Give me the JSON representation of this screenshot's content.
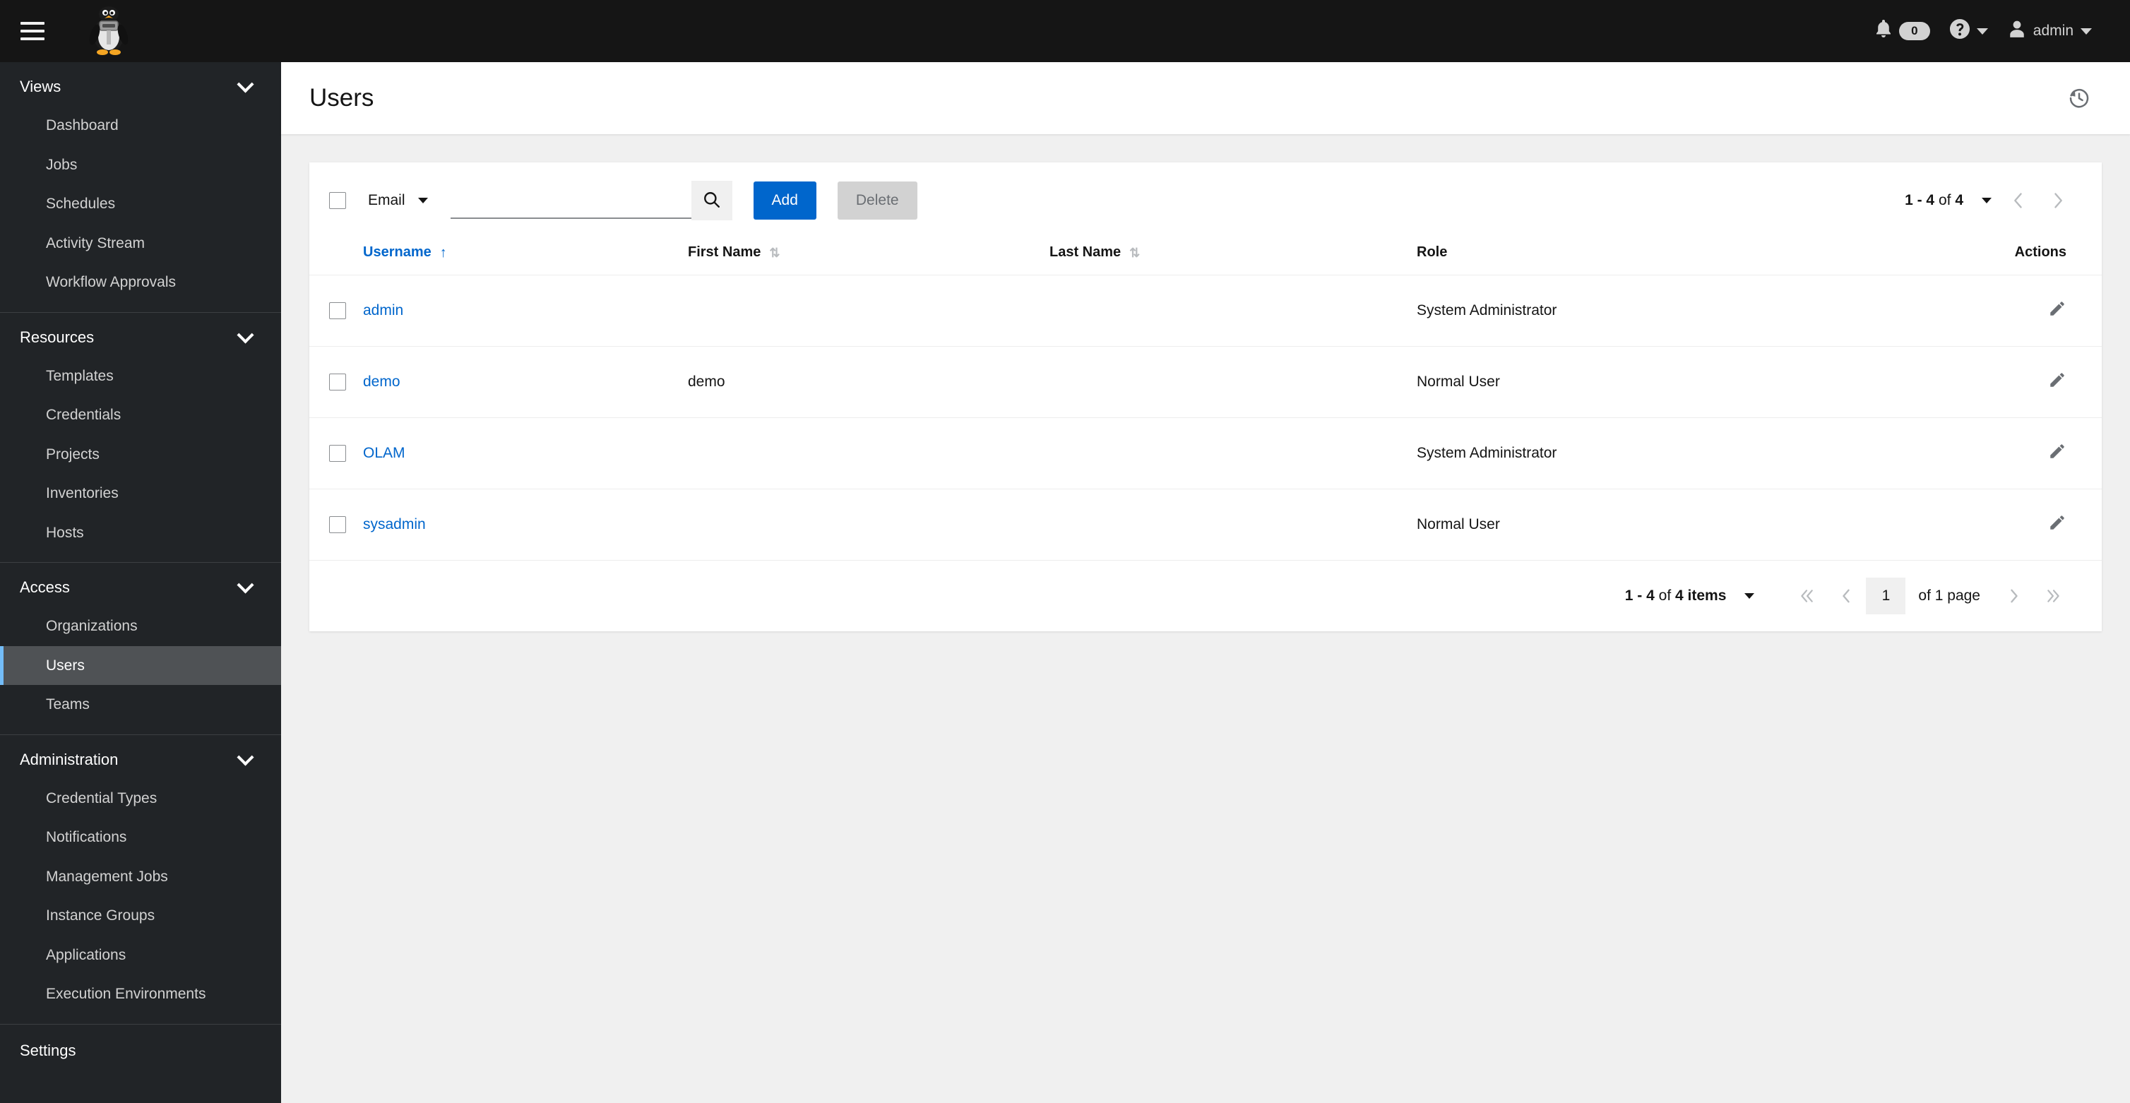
{
  "masthead": {
    "menu_icon": "hamburger-icon",
    "logo_icon": "penguin-logo",
    "notifications": {
      "icon": "bell-icon",
      "count": "0"
    },
    "help": {
      "icon": "question-circle-icon"
    },
    "user": {
      "icon": "user-icon",
      "name": "admin"
    }
  },
  "sidebar": {
    "groups": [
      {
        "label": "Views",
        "items": [
          {
            "label": "Dashboard",
            "active": false
          },
          {
            "label": "Jobs",
            "active": false
          },
          {
            "label": "Schedules",
            "active": false
          },
          {
            "label": "Activity Stream",
            "active": false
          },
          {
            "label": "Workflow Approvals",
            "active": false
          }
        ]
      },
      {
        "label": "Resources",
        "items": [
          {
            "label": "Templates",
            "active": false
          },
          {
            "label": "Credentials",
            "active": false
          },
          {
            "label": "Projects",
            "active": false
          },
          {
            "label": "Inventories",
            "active": false
          },
          {
            "label": "Hosts",
            "active": false
          }
        ]
      },
      {
        "label": "Access",
        "items": [
          {
            "label": "Organizations",
            "active": false
          },
          {
            "label": "Users",
            "active": true
          },
          {
            "label": "Teams",
            "active": false
          }
        ]
      },
      {
        "label": "Administration",
        "items": [
          {
            "label": "Credential Types",
            "active": false
          },
          {
            "label": "Notifications",
            "active": false
          },
          {
            "label": "Management Jobs",
            "active": false
          },
          {
            "label": "Instance Groups",
            "active": false
          },
          {
            "label": "Applications",
            "active": false
          },
          {
            "label": "Execution Environments",
            "active": false
          }
        ]
      }
    ],
    "settings_label": "Settings"
  },
  "page": {
    "title": "Users",
    "history_icon": "history-icon"
  },
  "toolbar": {
    "select_all_checkbox": "",
    "filter_field": "Email",
    "search_value": "",
    "search_placeholder": "",
    "search_icon": "search-icon",
    "add_label": "Add",
    "delete_label": "Delete",
    "pagination": {
      "summary_range": "1 - 4",
      "summary_of": "of",
      "summary_total": "4",
      "prev_icon": "chevron-left-icon",
      "next_icon": "chevron-right-icon"
    }
  },
  "table": {
    "columns": [
      {
        "label": "Username",
        "sort": "asc"
      },
      {
        "label": "First Name",
        "sort": "none"
      },
      {
        "label": "Last Name",
        "sort": "none"
      },
      {
        "label": "Role",
        "sort": null
      },
      {
        "label": "Actions",
        "sort": null
      }
    ],
    "rows": [
      {
        "username": "admin",
        "first_name": "",
        "last_name": "",
        "role": "System Administrator",
        "edit_icon": "pencil-icon"
      },
      {
        "username": "demo",
        "first_name": "demo",
        "last_name": "",
        "role": "Normal User",
        "edit_icon": "pencil-icon"
      },
      {
        "username": "OLAM",
        "first_name": "",
        "last_name": "",
        "role": "System Administrator",
        "edit_icon": "pencil-icon"
      },
      {
        "username": "sysadmin",
        "first_name": "",
        "last_name": "",
        "role": "Normal User",
        "edit_icon": "pencil-icon"
      }
    ]
  },
  "bottom_pagination": {
    "summary_range": "1 - 4",
    "summary_of": "of",
    "summary_total": "4 items",
    "first_icon": "angle-double-left-icon",
    "prev_icon": "angle-left-icon",
    "page_value": "1",
    "of_pages": "of 1 page",
    "next_icon": "angle-right-icon",
    "last_icon": "angle-double-right-icon"
  },
  "colors": {
    "accent_blue": "#0066cc",
    "link_blue": "#0066cc",
    "sidebar_bg": "#212427",
    "masthead_bg": "#151515",
    "active_item_border": "#73bcf7",
    "page_bg": "#f0f0f0"
  }
}
